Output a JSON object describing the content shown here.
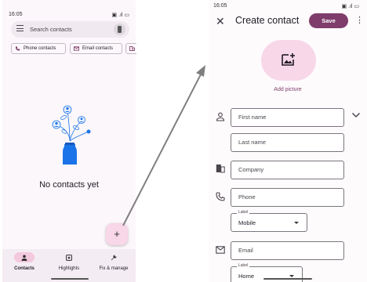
{
  "left": {
    "status": {
      "time": "16:05",
      "icons": "▣ .ıl ▭"
    },
    "search": {
      "placeholder": "Search contacts"
    },
    "chips": [
      {
        "label": "Phone contacts",
        "icon": "phone-icon"
      },
      {
        "label": "Email contacts",
        "icon": "mail-icon"
      },
      {
        "label": "",
        "icon": "business-icon"
      }
    ],
    "empty_message": "No contacts yet",
    "fab_label": "+",
    "nav": [
      {
        "label": "Contacts",
        "icon": "person-icon",
        "active": true
      },
      {
        "label": "Highlights",
        "icon": "highlights-icon",
        "active": false
      },
      {
        "label": "Fix & manage",
        "icon": "wrench-icon",
        "active": false
      }
    ]
  },
  "right": {
    "status": {
      "time": "16:05",
      "icons": "▣ .ıl ▭"
    },
    "close": "✕",
    "title": "Create contact",
    "save_label": "Save",
    "more": "⋮",
    "add_picture": "Add picture",
    "fields": {
      "first_name": "First name",
      "last_name": "Last name",
      "company": "Company",
      "phone": "Phone",
      "email": "Email"
    },
    "phone_label": {
      "label": "Label",
      "value": "Mobile"
    },
    "email_label": {
      "label": "Label",
      "value": "Home"
    }
  },
  "colors": {
    "accent": "#7e3d6a",
    "accent_container": "#f7d7e8",
    "surface": "#fcf7fb"
  }
}
